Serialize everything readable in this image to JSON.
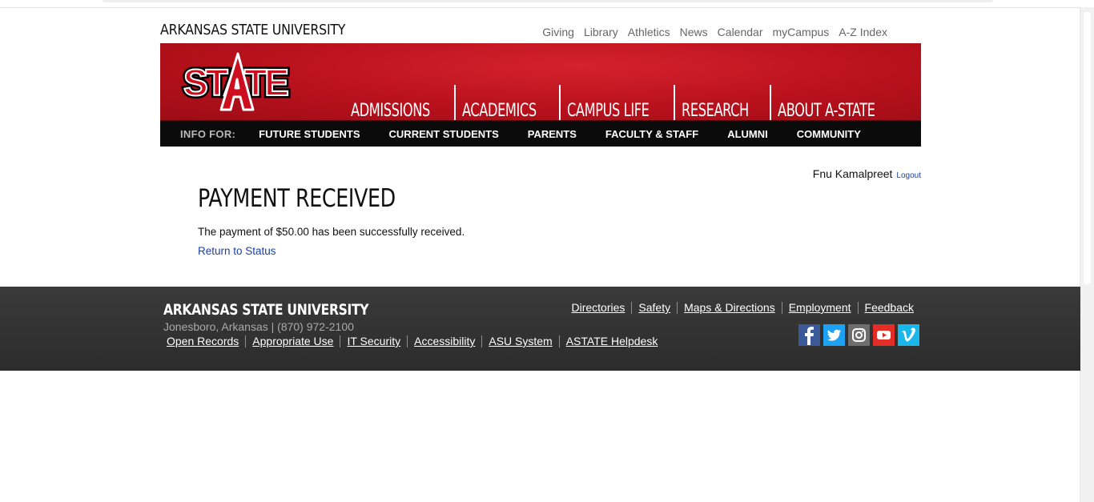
{
  "header": {
    "brand": "ARKANSAS STATE UNIVERSITY",
    "utility_links": [
      "Giving",
      "Library",
      "Athletics",
      "News",
      "Calendar",
      "myCampus",
      "A-Z Index"
    ],
    "logo_text": "STATE",
    "main_nav": [
      "ADMISSIONS",
      "ACADEMICS",
      "CAMPUS LIFE",
      "RESEARCH",
      "ABOUT A-STATE"
    ],
    "info_for_label": "INFO FOR:",
    "audiences": [
      "FUTURE STUDENTS",
      "CURRENT STUDENTS",
      "PARENTS",
      "FACULTY & STAFF",
      "ALUMNI",
      "COMMUNITY"
    ]
  },
  "user": {
    "name": "Fnu Kamalpreet",
    "logout_label": "Logout"
  },
  "main": {
    "title": "PAYMENT RECEIVED",
    "message": "The payment of $50.00 has been successfully received.",
    "return_link": "Return to Status"
  },
  "footer": {
    "brand": "ARKANSAS STATE UNIVERSITY",
    "address": "Jonesboro, Arkansas | (870) 972-2100",
    "links_top": [
      "Directories",
      "Safety",
      "Maps & Directions",
      "Employment",
      "Feedback"
    ],
    "links_bottom": [
      "Open Records",
      "Appropriate Use",
      "IT Security",
      "Accessibility",
      "ASU System",
      "ASTATE Helpdesk"
    ],
    "social": [
      {
        "name": "facebook-icon",
        "glyph": "f",
        "color": "#3b5998"
      },
      {
        "name": "twitter-icon",
        "glyph": "t",
        "color": "#1da1f2"
      },
      {
        "name": "instagram-icon",
        "glyph": "◎",
        "color": "#6e6e6e"
      },
      {
        "name": "youtube-icon",
        "glyph": "▶",
        "color": "#e52d27"
      },
      {
        "name": "vimeo-icon",
        "glyph": "v",
        "color": "#1ab7ea"
      }
    ]
  },
  "colors": {
    "brand_red": "#cc0e1e",
    "black_bar": "#0b0b0b",
    "footer_bg": "#333333",
    "link_blue": "#1a3fa8"
  }
}
